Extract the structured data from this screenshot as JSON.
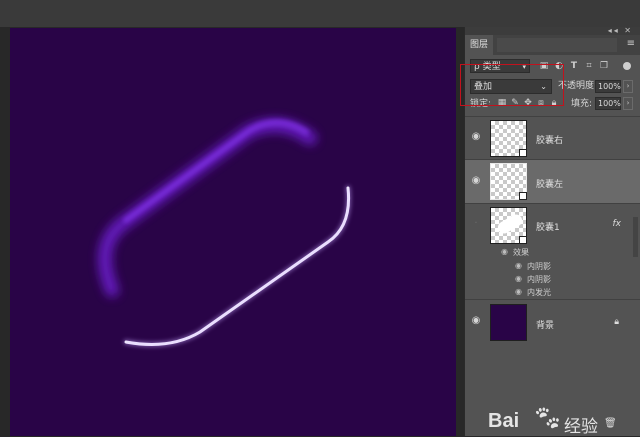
{
  "panel": {
    "tab_label": "图层",
    "menu_icon": "menu-icon",
    "collapse_icon": "double-arrow-icon"
  },
  "filter": {
    "kind_label": "ρ 类型",
    "icons": [
      "image-filter-icon",
      "adjustment-filter-icon",
      "type-filter-icon",
      "shape-filter-icon",
      "smart-object-filter-icon"
    ]
  },
  "blend": {
    "mode": "叠加",
    "opacity_label": "不透明度:",
    "opacity_value": "100%"
  },
  "lock": {
    "label": "锁定:",
    "fill_label": "填充:",
    "fill_value": "100%"
  },
  "layers": [
    {
      "name": "胶囊右",
      "visible": true,
      "selected": false
    },
    {
      "name": "胶囊左",
      "visible": true,
      "selected": true
    },
    {
      "name": "胶囊1",
      "visible": false,
      "selected": false,
      "fx": "fx",
      "effects_label": "效果",
      "effects": [
        "内阴影",
        "内阴影",
        "内发光"
      ]
    },
    {
      "name": "背景",
      "visible": true,
      "selected": false,
      "locked": true
    }
  ],
  "watermark": {
    "brand": "Bai",
    "suffix": "经验"
  },
  "colors": {
    "canvas_bg": "#290447",
    "glow": "#6a1fc9",
    "panel_bg": "#535353",
    "highlight_rect": "#c2121d"
  }
}
